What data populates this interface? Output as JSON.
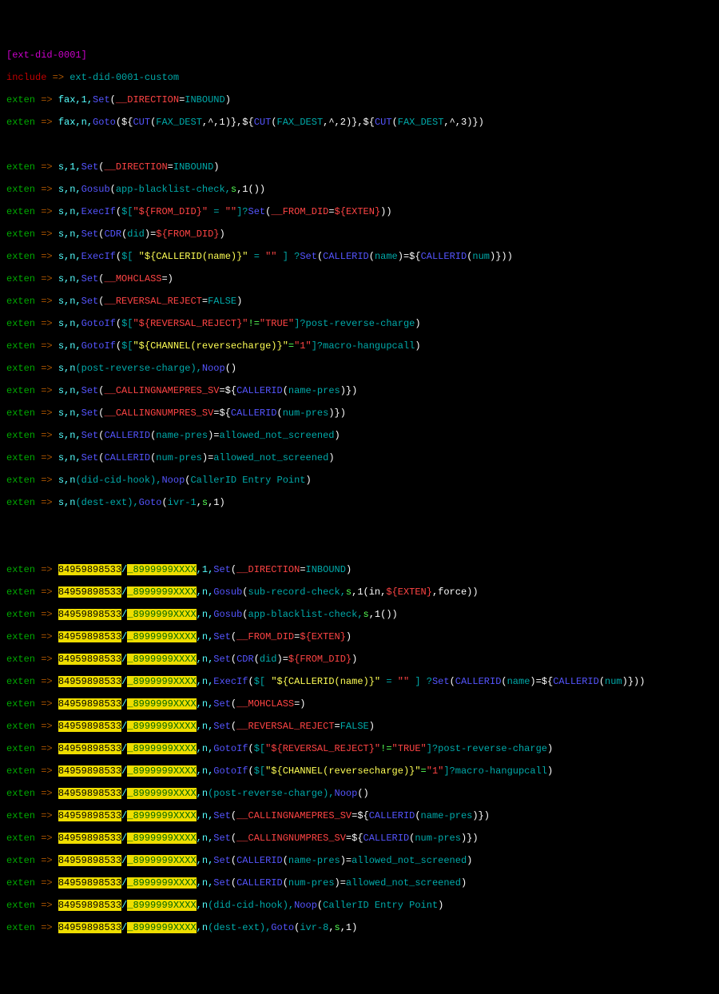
{
  "context": "[ext-did-0001]",
  "include_kw": "include",
  "include_ctx": "ext-did-0001-custom",
  "arrow": " => ",
  "exten": "exten",
  "inbound": "INBOUND",
  "false_": "FALSE",
  "true_": "TRUE",
  "empty": "\"\"",
  "num1a": "84959898533",
  "sep1": "/",
  "num1b": "_8999999XXXX",
  "fax1_ext": "fax,1,",
  "fax1_app": "Set",
  "fax1_v": "__DIRECTION",
  "fax2_ext": "fax,n,",
  "fax2_app": "Goto",
  "fax2_cut": "CUT",
  "fax2_fd": "FAX_DEST",
  "fax2_c1": ",^,1",
  "fax2_c2": ",^,2",
  "fax2_c3": ",^,3",
  "s1_ext": "s,1,",
  "s1_app": "Set",
  "s1_v": "__DIRECTION",
  "s2_ext": "s,n,",
  "s2_app": "Gosub",
  "s2_a": "app-blacklist-check,",
  "s2_b": "s",
  "s2_c": ",1()",
  "s3_ext": "s,n,",
  "s3_app": "ExecIf",
  "s3_a": "$[",
  "s3_b": "\"${FROM_DID}\"",
  "s3_c": " = ",
  "s3_d": "]?",
  "s3_e": "Set",
  "s3_v": "__FROM_DID",
  "s3_f": "${EXTEN}",
  "s4_ext": "s,n,",
  "s4_app": "Set",
  "s4_a": "CDR",
  "s4_b": "did",
  "s4_c": "${FROM_DID}",
  "s5_ext": "s,n,",
  "s5_app": "ExecIf",
  "s5_a": "$[ ",
  "s5_b": "\"${CALLERID(name)}\"",
  "s5_c": " = ",
  "s5_d": " ] ?",
  "s5_e": "Set",
  "s5_f": "CALLERID",
  "s5_g": "name",
  "s5_h": "CALLERID",
  "s5_i": "num",
  "s6_ext": "s,n,",
  "s6_app": "Set",
  "s6_v": "__MOHCLASS",
  "s7_ext": "s,n,",
  "s7_app": "Set",
  "s7_v": "__REVERSAL_REJECT",
  "s8_ext": "s,n,",
  "s8_app": "GotoIf",
  "s8_a": "$[",
  "s8_b": "\"${REVERSAL_REJECT}\"",
  "s8_c": "!=",
  "s8_d": "\"TRUE\"",
  "s8_e": "]?post-reverse-charge",
  "s9_ext": "s,n,",
  "s9_app": "GotoIf",
  "s9_a": "$[",
  "s9_b": "\"${CHANNEL(reversecharge)}\"",
  "s9_c": "=",
  "s9_d": "\"1\"",
  "s9_e": "]?macro-hangupcall",
  "s10_ext": "s,n",
  "s10_a": "(post-reverse-charge),",
  "s10_app": "Noop",
  "s11_ext": "s,n,",
  "s11_app": "Set",
  "s11_v": "__CALLINGNAMEPRES_SV",
  "s11_a": "CALLERID",
  "s11_b": "name-pres",
  "s12_ext": "s,n,",
  "s12_app": "Set",
  "s12_v": "__CALLINGNUMPRES_SV",
  "s12_a": "CALLERID",
  "s12_b": "num-pres",
  "s13_ext": "s,n,",
  "s13_app": "Set",
  "s13_a": "CALLERID",
  "s13_b": "name-pres",
  "s13_c": "allowed_not_screened",
  "s14_ext": "s,n,",
  "s14_app": "Set",
  "s14_a": "CALLERID",
  "s14_b": "num-pres",
  "s14_c": "allowed_not_screened",
  "s15_ext": "s,n",
  "s15_a": "(did-cid-hook),",
  "s15_app": "Noop",
  "s15_b": "CallerID Entry Point",
  "s16_ext": "s,n",
  "s16_a": "(dest-ext),",
  "s16_app": "Goto",
  "s16_b": "ivr-1",
  "s16_c": "s",
  "s16_d": ",1",
  "n1_e": ",1,",
  "n1_app": "Set",
  "n1_v": "__DIRECTION",
  "n2_e": ",n,",
  "n2_app": "Gosub",
  "n2_a": "sub-record-check,",
  "n2_b": "s",
  "n2_c": ",1(in,",
  "n2_d": "${EXTEN}",
  "n2_f": ",force)",
  "n3_e": ",n,",
  "n3_app": "Gosub",
  "n3_a": "app-blacklist-check,",
  "n3_b": "s",
  "n3_c": ",1()",
  "n4_e": ",n,",
  "n4_app": "Set",
  "n4_v": "__FROM_DID",
  "n4_a": "${EXTEN}",
  "n5_e": ",n,",
  "n5_app": "Set",
  "n5_a": "CDR",
  "n5_b": "did",
  "n5_c": "${FROM_DID}",
  "n6_e": ",n,",
  "n6_app": "ExecIf",
  "n6_a": "$[ ",
  "n6_b": "\"${CALLERID(name)}\"",
  "n6_c": " = ",
  "n6_d": " ] ?",
  "n6_e2": "Set",
  "n6_f": "CALLERID",
  "n6_g": "name",
  "n6_h": "CALLERID",
  "n6_i": "num",
  "n7_e": ",n,",
  "n7_app": "Set",
  "n7_v": "__MOHCLASS",
  "n8_e": ",n,",
  "n8_app": "Set",
  "n8_v": "__REVERSAL_REJECT",
  "n9_e": ",n,",
  "n9_app": "GotoIf",
  "n9_a": "$[",
  "n9_b": "\"${REVERSAL_REJECT}\"",
  "n9_c": "!=",
  "n9_d": "\"TRUE\"",
  "n9_e2": "]?post-reverse-charge",
  "n10_e": ",n,",
  "n10_app": "GotoIf",
  "n10_a": "$[",
  "n10_b": "\"${CHANNEL(reversecharge)}\"",
  "n10_c": "=",
  "n10_d": "\"1\"",
  "n10_e2": "]?macro-hangupcall",
  "n11_e": ",n",
  "n11_a": "(post-reverse-charge),",
  "n11_app": "Noop",
  "n12_e": ",n,",
  "n12_app": "Set",
  "n12_v": "__CALLINGNAMEPRES_SV",
  "n12_a": "CALLERID",
  "n12_b": "name-pres",
  "n13_e": ",n,",
  "n13_app": "Set",
  "n13_v": "__CALLINGNUMPRES_SV",
  "n13_a": "CALLERID",
  "n13_b": "num-pres",
  "n14_e": ",n,",
  "n14_app": "Set",
  "n14_a": "CALLERID",
  "n14_b": "name-pres",
  "n14_c": "allowed_not_screened",
  "n15_e": ",n,",
  "n15_app": "Set",
  "n15_a": "CALLERID",
  "n15_b": "num-pres",
  "n15_c": "allowed_not_screened",
  "n16_e": ",n",
  "n16_a": "(did-cid-hook),",
  "n16_app": "Noop",
  "n16_b": "CallerID Entry Point",
  "n17_e": ",n",
  "n17_a": "(dest-ext),",
  "n17_app": "Goto",
  "n17_b": "ivr-8",
  "n17_c": "s",
  "n17_d": ",1"
}
